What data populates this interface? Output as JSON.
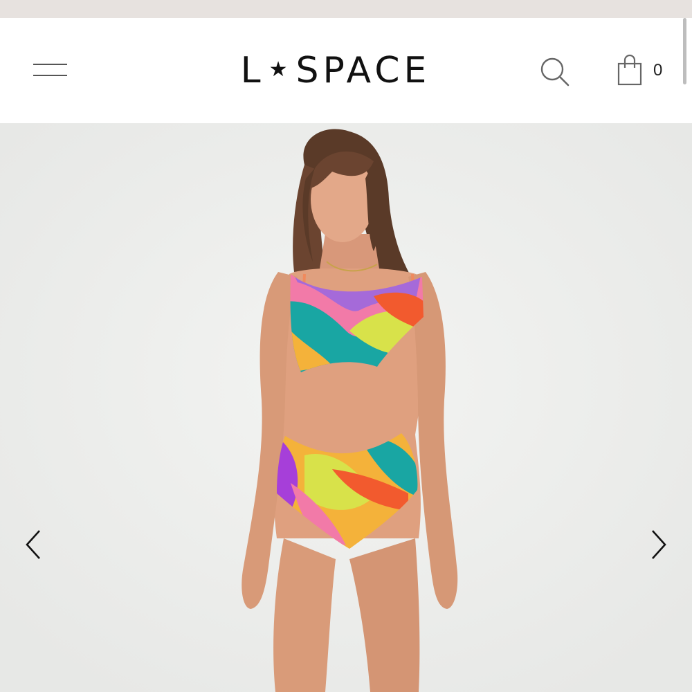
{
  "header": {
    "brand_left": "L",
    "brand_star": "★",
    "brand_right": "SPACE",
    "cart_count": "0",
    "icons": {
      "menu": "hamburger-menu-icon",
      "search": "search-icon",
      "cart": "shopping-bag-icon"
    }
  },
  "gallery": {
    "prev_icon": "chevron-left-icon",
    "next_icon": "chevron-right-icon"
  },
  "colors": {
    "promo_bar": "#e7e2df",
    "background": "#ebecea",
    "text": "#111111"
  }
}
